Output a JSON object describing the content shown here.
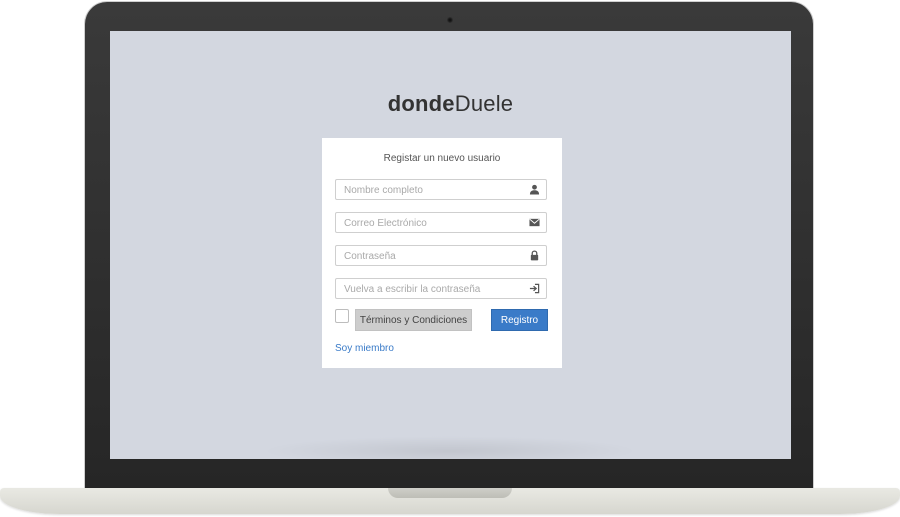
{
  "app": {
    "logo_bold": "donde",
    "logo_light": "Duele"
  },
  "register_form": {
    "title": "Registar un nuevo usuario",
    "fields": [
      {
        "placeholder": "Nombre completo",
        "icon": "user-icon"
      },
      {
        "placeholder": "Correo Electrónico",
        "icon": "envelope-icon"
      },
      {
        "placeholder": "Contraseña",
        "icon": "lock-icon"
      },
      {
        "placeholder": "Vuelva a escribir la contraseña",
        "icon": "login-icon"
      }
    ],
    "terms_label": "Términos y Condiciones",
    "terms_checked": false,
    "submit_label": "Registro",
    "member_link": "Soy miembro"
  },
  "colors": {
    "screen_background": "#d3d7e0",
    "primary": "#3a7bc8",
    "terms_button": "#cdcdcd",
    "bezel": "#2b2b2b"
  }
}
